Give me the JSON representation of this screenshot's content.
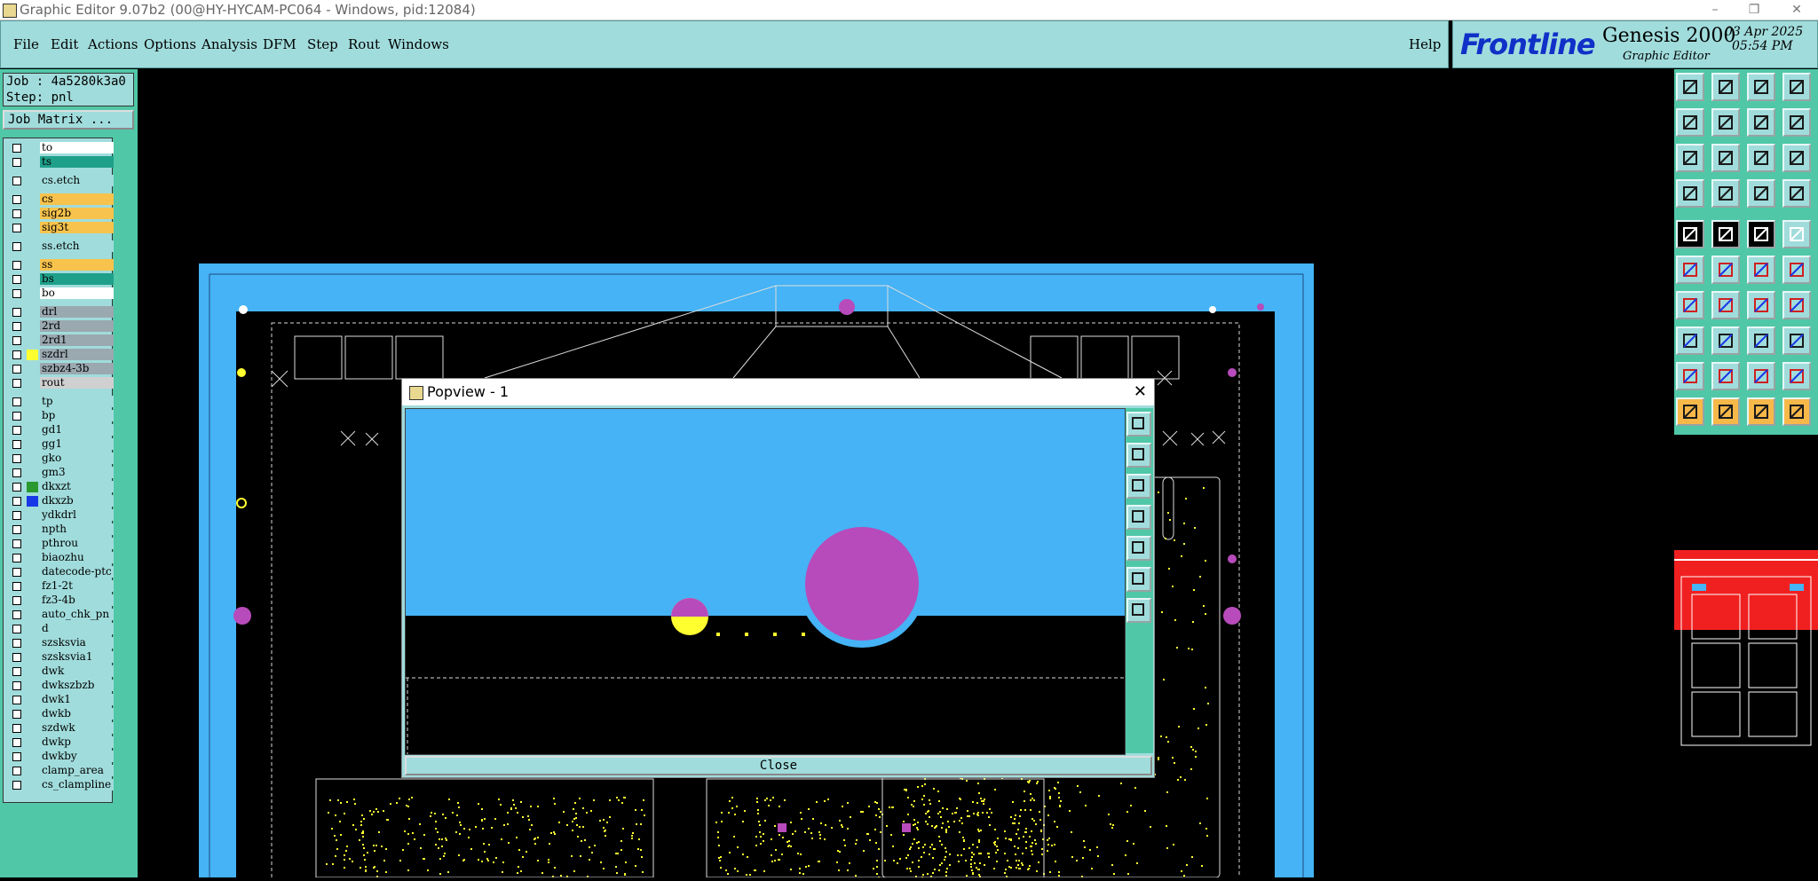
{
  "window": {
    "title": "Graphic Editor 9.07b2 (00@HY-HYCAM-PC064 - Windows, pid:12084)"
  },
  "menu": {
    "items": [
      "File",
      "Edit",
      "Actions",
      "Options",
      "Analysis",
      "DFM",
      "Step",
      "Rout",
      "Windows"
    ],
    "help": "Help"
  },
  "brand": {
    "logo": "Frontline",
    "product": "Genesis 2000",
    "subtitle": "Graphic Editor",
    "date": "03 Apr 2025",
    "time": "05:54 PM"
  },
  "job": {
    "job_line": "Job : 4a5280k3a0",
    "step_line": "Step: pnl",
    "matrix_button": "Job Matrix ..."
  },
  "layers": [
    {
      "name": "to",
      "bg": "#ffffff",
      "swatch": ""
    },
    {
      "name": "ts",
      "bg": "#1fa08a",
      "swatch": ""
    },
    {
      "name": "cs.etch",
      "bg": "#a1dcdc",
      "swatch": ""
    },
    {
      "name": "cs",
      "bg": "#f7c34c",
      "swatch": ""
    },
    {
      "name": "sig2b",
      "bg": "#f7c34c",
      "swatch": ""
    },
    {
      "name": "sig3t",
      "bg": "#f7c34c",
      "swatch": ""
    },
    {
      "name": "ss.etch",
      "bg": "#a1dcdc",
      "swatch": ""
    },
    {
      "name": "ss",
      "bg": "#f7c34c",
      "swatch": ""
    },
    {
      "name": "bs",
      "bg": "#1fa08a",
      "swatch": ""
    },
    {
      "name": "bo",
      "bg": "#ffffff",
      "swatch": ""
    },
    {
      "name": "drl",
      "bg": "#9aa8b0",
      "swatch": ""
    },
    {
      "name": "2rd",
      "bg": "#9aa8b0",
      "swatch": ""
    },
    {
      "name": "2rd1",
      "bg": "#9aa8b0",
      "swatch": ""
    },
    {
      "name": "szdrl",
      "bg": "#9aa8b0",
      "swatch": "#ffff30"
    },
    {
      "name": "szbz4-3b",
      "bg": "#9aa8b0",
      "swatch": ""
    },
    {
      "name": "rout",
      "bg": "#d0d0d0",
      "swatch": ""
    },
    {
      "name": "tp",
      "bg": "#a1dcdc",
      "swatch": ""
    },
    {
      "name": "bp",
      "bg": "#a1dcdc",
      "swatch": ""
    },
    {
      "name": "gd1",
      "bg": "#a1dcdc",
      "swatch": ""
    },
    {
      "name": "gg1",
      "bg": "#a1dcdc",
      "swatch": ""
    },
    {
      "name": "gko",
      "bg": "#a1dcdc",
      "swatch": ""
    },
    {
      "name": "gm3",
      "bg": "#a1dcdc",
      "swatch": ""
    },
    {
      "name": "dkxzt",
      "bg": "#a1dcdc",
      "swatch": "#2a9a30"
    },
    {
      "name": "dkxzb",
      "bg": "#a1dcdc",
      "swatch": "#1838e8"
    },
    {
      "name": "ydkdrl",
      "bg": "#a1dcdc",
      "swatch": ""
    },
    {
      "name": "npth",
      "bg": "#a1dcdc",
      "swatch": ""
    },
    {
      "name": "pthrou",
      "bg": "#a1dcdc",
      "swatch": ""
    },
    {
      "name": "biaozhu",
      "bg": "#a1dcdc",
      "swatch": ""
    },
    {
      "name": "datecode-ptc",
      "bg": "#a1dcdc",
      "swatch": ""
    },
    {
      "name": "fz1-2t",
      "bg": "#a1dcdc",
      "swatch": ""
    },
    {
      "name": "fz3-4b",
      "bg": "#a1dcdc",
      "swatch": ""
    },
    {
      "name": "auto_chk_pn",
      "bg": "#a1dcdc",
      "swatch": ""
    },
    {
      "name": "d",
      "bg": "#a1dcdc",
      "swatch": ""
    },
    {
      "name": "szsksvia",
      "bg": "#a1dcdc",
      "swatch": ""
    },
    {
      "name": "szsksvia1",
      "bg": "#a1dcdc",
      "swatch": ""
    },
    {
      "name": "dwk",
      "bg": "#a1dcdc",
      "swatch": ""
    },
    {
      "name": "dwkszbzb",
      "bg": "#a1dcdc",
      "swatch": ""
    },
    {
      "name": "dwk1",
      "bg": "#a1dcdc",
      "swatch": ""
    },
    {
      "name": "dwkb",
      "bg": "#a1dcdc",
      "swatch": ""
    },
    {
      "name": "szdwk",
      "bg": "#a1dcdc",
      "swatch": ""
    },
    {
      "name": "dwkp",
      "bg": "#a1dcdc",
      "swatch": ""
    },
    {
      "name": "dwkby",
      "bg": "#a1dcdc",
      "swatch": ""
    },
    {
      "name": "clamp_area",
      "bg": "#a1dcdc",
      "swatch": ""
    },
    {
      "name": "cs_clampline",
      "bg": "#a1dcdc",
      "swatch": ""
    }
  ],
  "popview": {
    "title": "Popview - 1",
    "close_label": "Close"
  },
  "colors": {
    "panel": "#a1dcdc",
    "panel_dark": "#50c8a8",
    "board_blue": "#45b3f5",
    "pad_magenta": "#b84bbb",
    "pad_yellow": "#ffff30"
  },
  "tools": [
    "open-job-icon",
    "save-job-icon",
    "home-icon",
    "window-layout-icon",
    "zoom-in-icon",
    "zoom-out-icon",
    "zoom-fit-icon",
    "zoom-area-icon",
    "fit-all-icon",
    "pan-icon",
    "scale-1-2-icon",
    "help-icon",
    "snap-icon",
    "grid-icon",
    "layers-link-icon",
    "layers-link2-icon",
    "measure-pad-icon",
    "line-icon",
    "rectangle-icon",
    "circle-icon",
    "move-node-icon",
    "cross-icon",
    "connect-icon",
    "connect2-icon",
    "angle-icon",
    "slash-icon",
    "rotate-icon",
    "mirror-icon",
    "select-box-icon",
    "minus-icon",
    "bounds-icon",
    "copy-icon",
    "triangle-icon",
    "triangle2-icon",
    "arc-icon",
    "arc2-icon",
    "select-arrow-icon",
    "select-arrow2-icon",
    "select-arrow3-icon",
    "select-arrow4-icon"
  ]
}
